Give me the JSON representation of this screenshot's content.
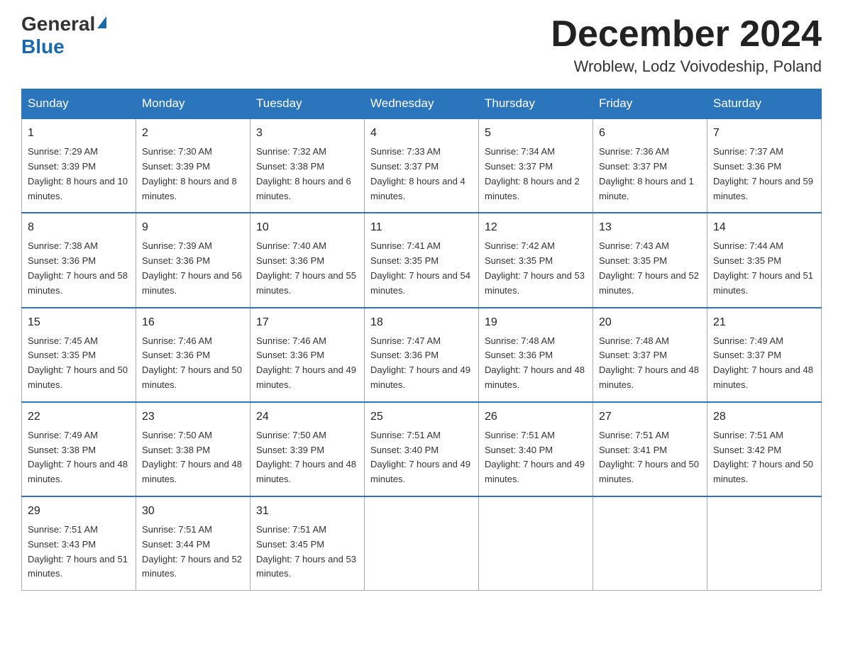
{
  "header": {
    "logo_general": "General",
    "logo_blue": "Blue",
    "month_title": "December 2024",
    "location": "Wroblew, Lodz Voivodeship, Poland"
  },
  "days_of_week": [
    "Sunday",
    "Monday",
    "Tuesday",
    "Wednesday",
    "Thursday",
    "Friday",
    "Saturday"
  ],
  "weeks": [
    [
      {
        "day": "1",
        "sunrise": "7:29 AM",
        "sunset": "3:39 PM",
        "daylight": "8 hours and 10 minutes."
      },
      {
        "day": "2",
        "sunrise": "7:30 AM",
        "sunset": "3:39 PM",
        "daylight": "8 hours and 8 minutes."
      },
      {
        "day": "3",
        "sunrise": "7:32 AM",
        "sunset": "3:38 PM",
        "daylight": "8 hours and 6 minutes."
      },
      {
        "day": "4",
        "sunrise": "7:33 AM",
        "sunset": "3:37 PM",
        "daylight": "8 hours and 4 minutes."
      },
      {
        "day": "5",
        "sunrise": "7:34 AM",
        "sunset": "3:37 PM",
        "daylight": "8 hours and 2 minutes."
      },
      {
        "day": "6",
        "sunrise": "7:36 AM",
        "sunset": "3:37 PM",
        "daylight": "8 hours and 1 minute."
      },
      {
        "day": "7",
        "sunrise": "7:37 AM",
        "sunset": "3:36 PM",
        "daylight": "7 hours and 59 minutes."
      }
    ],
    [
      {
        "day": "8",
        "sunrise": "7:38 AM",
        "sunset": "3:36 PM",
        "daylight": "7 hours and 58 minutes."
      },
      {
        "day": "9",
        "sunrise": "7:39 AM",
        "sunset": "3:36 PM",
        "daylight": "7 hours and 56 minutes."
      },
      {
        "day": "10",
        "sunrise": "7:40 AM",
        "sunset": "3:36 PM",
        "daylight": "7 hours and 55 minutes."
      },
      {
        "day": "11",
        "sunrise": "7:41 AM",
        "sunset": "3:35 PM",
        "daylight": "7 hours and 54 minutes."
      },
      {
        "day": "12",
        "sunrise": "7:42 AM",
        "sunset": "3:35 PM",
        "daylight": "7 hours and 53 minutes."
      },
      {
        "day": "13",
        "sunrise": "7:43 AM",
        "sunset": "3:35 PM",
        "daylight": "7 hours and 52 minutes."
      },
      {
        "day": "14",
        "sunrise": "7:44 AM",
        "sunset": "3:35 PM",
        "daylight": "7 hours and 51 minutes."
      }
    ],
    [
      {
        "day": "15",
        "sunrise": "7:45 AM",
        "sunset": "3:35 PM",
        "daylight": "7 hours and 50 minutes."
      },
      {
        "day": "16",
        "sunrise": "7:46 AM",
        "sunset": "3:36 PM",
        "daylight": "7 hours and 50 minutes."
      },
      {
        "day": "17",
        "sunrise": "7:46 AM",
        "sunset": "3:36 PM",
        "daylight": "7 hours and 49 minutes."
      },
      {
        "day": "18",
        "sunrise": "7:47 AM",
        "sunset": "3:36 PM",
        "daylight": "7 hours and 49 minutes."
      },
      {
        "day": "19",
        "sunrise": "7:48 AM",
        "sunset": "3:36 PM",
        "daylight": "7 hours and 48 minutes."
      },
      {
        "day": "20",
        "sunrise": "7:48 AM",
        "sunset": "3:37 PM",
        "daylight": "7 hours and 48 minutes."
      },
      {
        "day": "21",
        "sunrise": "7:49 AM",
        "sunset": "3:37 PM",
        "daylight": "7 hours and 48 minutes."
      }
    ],
    [
      {
        "day": "22",
        "sunrise": "7:49 AM",
        "sunset": "3:38 PM",
        "daylight": "7 hours and 48 minutes."
      },
      {
        "day": "23",
        "sunrise": "7:50 AM",
        "sunset": "3:38 PM",
        "daylight": "7 hours and 48 minutes."
      },
      {
        "day": "24",
        "sunrise": "7:50 AM",
        "sunset": "3:39 PM",
        "daylight": "7 hours and 48 minutes."
      },
      {
        "day": "25",
        "sunrise": "7:51 AM",
        "sunset": "3:40 PM",
        "daylight": "7 hours and 49 minutes."
      },
      {
        "day": "26",
        "sunrise": "7:51 AM",
        "sunset": "3:40 PM",
        "daylight": "7 hours and 49 minutes."
      },
      {
        "day": "27",
        "sunrise": "7:51 AM",
        "sunset": "3:41 PM",
        "daylight": "7 hours and 50 minutes."
      },
      {
        "day": "28",
        "sunrise": "7:51 AM",
        "sunset": "3:42 PM",
        "daylight": "7 hours and 50 minutes."
      }
    ],
    [
      {
        "day": "29",
        "sunrise": "7:51 AM",
        "sunset": "3:43 PM",
        "daylight": "7 hours and 51 minutes."
      },
      {
        "day": "30",
        "sunrise": "7:51 AM",
        "sunset": "3:44 PM",
        "daylight": "7 hours and 52 minutes."
      },
      {
        "day": "31",
        "sunrise": "7:51 AM",
        "sunset": "3:45 PM",
        "daylight": "7 hours and 53 minutes."
      },
      null,
      null,
      null,
      null
    ]
  ],
  "labels": {
    "sunrise": "Sunrise:",
    "sunset": "Sunset:",
    "daylight": "Daylight:"
  }
}
